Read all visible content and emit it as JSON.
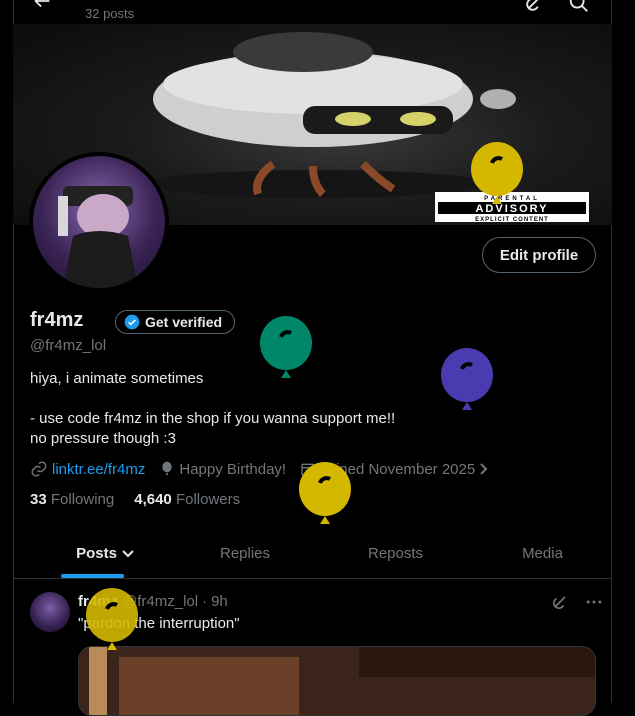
{
  "header": {
    "post_count": "32 posts"
  },
  "banner": {
    "advisory_line1": "PARENTAL",
    "advisory_line2": "ADVISORY",
    "advisory_line3": "EXPLICIT CONTENT"
  },
  "profile": {
    "edit_label": "Edit profile",
    "display_name": "fr4mz",
    "verified_label": "Get verified",
    "handle": "@fr4mz_lol",
    "bio": [
      "hiya, i animate sometimes",
      "",
      "- use code  fr4mz  in the shop if you wanna support me!!",
      "no pressure though :3"
    ],
    "link": "linktr.ee/fr4mz",
    "birthday": "Happy Birthday!",
    "joined": "Joined November 2025",
    "following_count": "33",
    "following_label": "Following",
    "followers_count": "4,640",
    "followers_label": "Followers"
  },
  "tabs": [
    "Posts",
    "Replies",
    "Reposts",
    "Media"
  ],
  "post": {
    "name": "fr4mz",
    "handle": "@fr4mz_lol",
    "sep": "·",
    "time": "9h",
    "text": "\"pardon the interruption\""
  },
  "colors": {
    "accent": "#1d9bf0",
    "balloon_yellow": "#d4b800",
    "balloon_green": "#00876a",
    "balloon_purple": "#4a3bb0"
  }
}
